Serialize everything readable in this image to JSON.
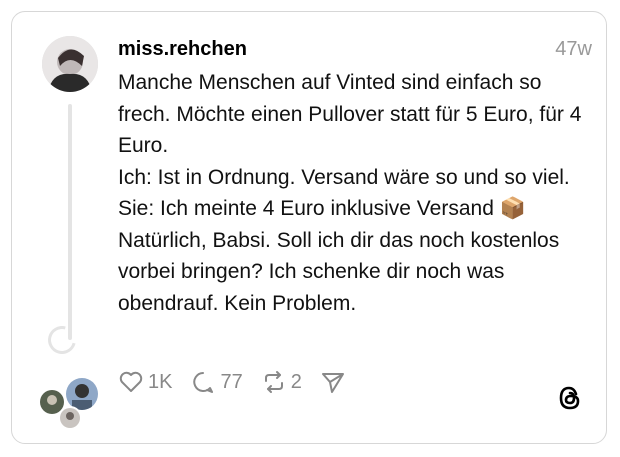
{
  "post": {
    "username": "miss.rehchen",
    "time": "47w",
    "lines": [
      "Manche Menschen auf Vinted sind einfach so frech. Möchte einen Pullover statt für 5 Euro, für 4 Euro.",
      "Ich: Ist in Ordnung. Versand wäre so und so viel.",
      "Sie: Ich meinte 4 Euro inklusive Versand 📦",
      "Natürlich, Babsi. Soll ich dir das noch kostenlos vorbei bringen? Ich schenke dir noch was obendrauf. Kein Problem."
    ]
  },
  "actions": {
    "likes": "1K",
    "comments": "77",
    "reposts": "2"
  },
  "icons": {
    "like": "heart-icon",
    "comment": "comment-icon",
    "repost": "repost-icon",
    "share": "send-icon",
    "brand": "threads-logo-icon"
  }
}
